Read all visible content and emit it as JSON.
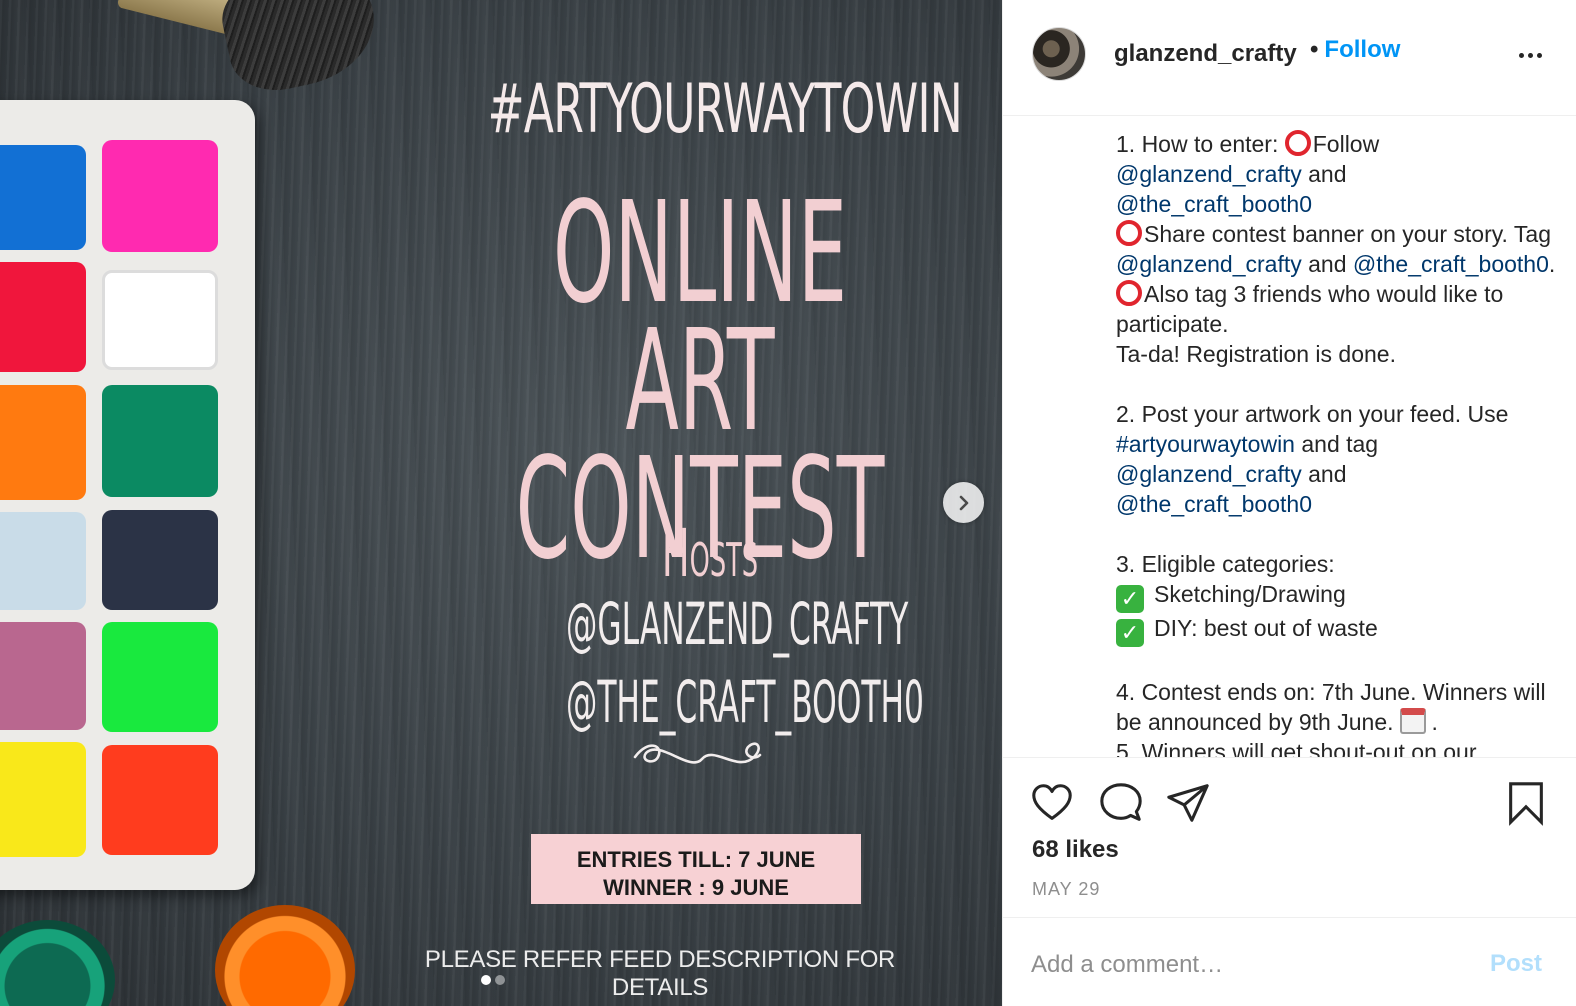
{
  "image": {
    "hashtag": "#ARTYOURWAYTOWIN",
    "title_line1": "ONLINE ART",
    "title_line2": "CONTEST",
    "hosts_label": "Hosts",
    "host_1": "@GLANZEND_CRAFTY",
    "host_2": "@THE_CRAFT_BOOTH0",
    "entries_line": "ENTRIES TILL: 7 JUNE",
    "winner_line": "WINNER : 9 JUNE",
    "footer_note": "PLEASE REFER FEED DESCRIPTION FOR DETAILS",
    "carousel_total": 2,
    "carousel_active": 1
  },
  "header": {
    "username": "glanzend_crafty",
    "separator": "•",
    "follow_label": "Follow"
  },
  "caption": {
    "step1_intro": "1. How to enter: ",
    "step1_follow": "Follow",
    "mention_glanzend": "@glanzend_crafty",
    "word_and": " and",
    "mention_craft": "@the_craft_booth0",
    "step1_share": "Share contest banner on your story. Tag ",
    "and_space": " and ",
    "period": ". ",
    "step1_tag3": "Also tag 3 friends who would like to participate.",
    "step1_done": "Ta-da! Registration is done.",
    "step2_text": "2. Post your artwork on your feed. Use",
    "hashtag_link": "#artyourwaytowin",
    "and_tag": " and tag",
    "step3_title": "3. Eligible categories:",
    "category_1": "Sketching/Drawing",
    "category_2": "DIY: best out of waste",
    "step4_text": "4. Contest ends on: 7th June. Winners will be announced by 9th June.",
    "step4_end": ".",
    "step5_text": "5. Winners will get shout-out on our"
  },
  "actions": {
    "likes": "68 likes",
    "date": "MAY 29"
  },
  "comment": {
    "placeholder": "Add a comment…",
    "post_label": "Post"
  },
  "colors": {
    "link_blue": "#00376b",
    "follow_blue": "#0095f6",
    "post_disabled": "#b2dffc",
    "title_pink": "#f2cfd2",
    "box_pink": "#f7d1d4"
  }
}
